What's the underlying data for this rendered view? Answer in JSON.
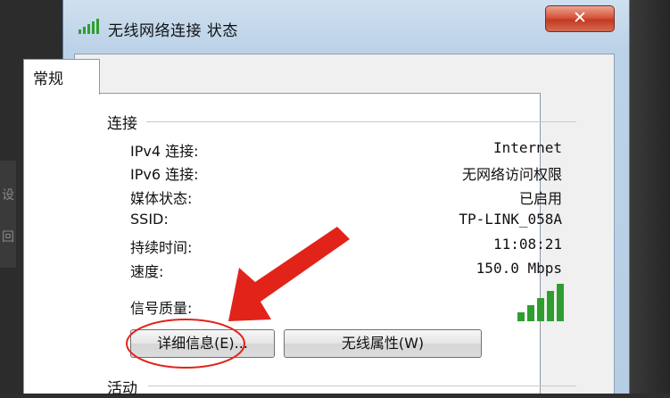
{
  "window": {
    "title": "无线网络连接 状态",
    "close_symbol": "✕"
  },
  "tabs": [
    {
      "label": "常规"
    }
  ],
  "connection": {
    "section_label": "连接",
    "rows": [
      {
        "label": "IPv4 连接:",
        "value": "Internet"
      },
      {
        "label": "IPv6 连接:",
        "value": "无网络访问权限"
      },
      {
        "label": "媒体状态:",
        "value": "已启用"
      },
      {
        "label": "SSID:",
        "value": "TP-LINK_058A"
      },
      {
        "label": "持续时间:",
        "value": "11:08:21"
      },
      {
        "label": "速度:",
        "value": "150.0 Mbps"
      }
    ],
    "signal_label": "信号质量:",
    "signal_bars_lit": 5,
    "signal_bars_total": 5
  },
  "buttons": {
    "details_label": "详细信息(E)...",
    "wireless_props_label": "无线属性(W)"
  },
  "activity": {
    "section_label": "活动"
  },
  "background": {
    "left_chars": [
      "设",
      "回"
    ]
  },
  "colors": {
    "accent_green": "#2e9e2e",
    "arrow_red": "#e2231a",
    "circle_red": "#e2231a",
    "close_red": "#c8452c"
  },
  "icons": {
    "title_icon": "wireless-signal-icon",
    "close_icon": "close-icon"
  }
}
